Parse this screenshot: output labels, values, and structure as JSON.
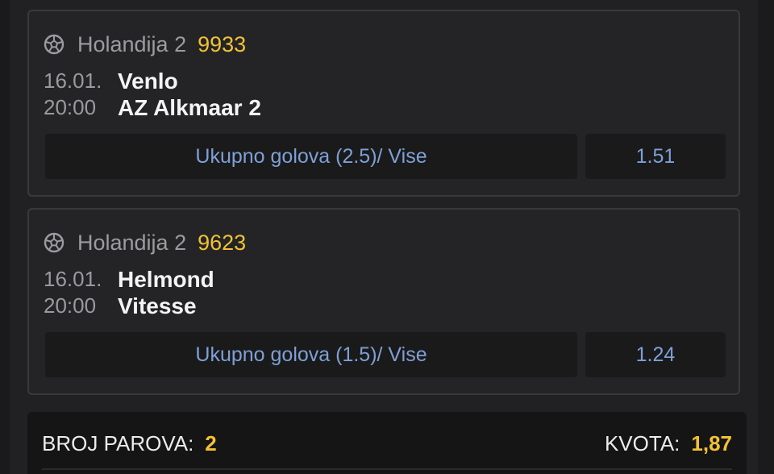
{
  "tickets": [
    {
      "league": "Holandija 2",
      "code": "9933",
      "date": "16.01.",
      "time": "20:00",
      "home": "Venlo",
      "away": "AZ Alkmaar 2",
      "bet": "Ukupno golova (2.5)/ Vise",
      "odd": "1.51",
      "icon": "soccer-ball-icon"
    },
    {
      "league": "Holandija 2",
      "code": "9623",
      "date": "16.01.",
      "time": "20:00",
      "home": "Helmond",
      "away": "Vitesse",
      "bet": "Ukupno golova (1.5)/ Vise",
      "odd": "1.24",
      "icon": "soccer-ball-icon"
    }
  ],
  "summary": {
    "pairs_label": "BROJ PAROVA:",
    "pairs_count": "2",
    "odds_label": "KVOTA:",
    "odds_value": "1,87"
  },
  "colors": {
    "accent": "#f2c233",
    "bet_text": "#7ea0d6",
    "card_border": "#39393b"
  }
}
